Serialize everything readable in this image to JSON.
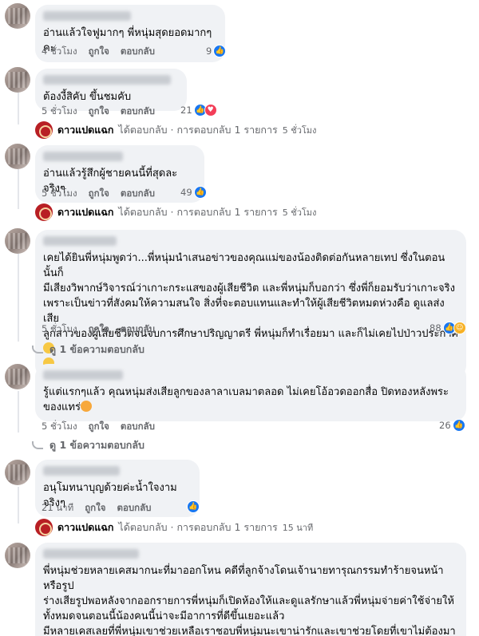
{
  "labels": {
    "like": "ถูกใจ",
    "reply": "ตอบกลับ",
    "replied_suffix": "ได้ตอบกลับ · การตอบกลับ 1 รายการ"
  },
  "page": {
    "name": "ดาวแปดแฉก"
  },
  "comments": [
    {
      "text": "อ่านแล้วใจฟูมากๆ พี่หนุ่มสุดยอดมากๆคะ",
      "time": "4 ชั่วโมง",
      "count": "9",
      "reactions": [
        "like"
      ]
    },
    {
      "text": "ต้องงี้สิคับ ขึ้นชมคับ",
      "time": "5 ชั่วโมง",
      "count": "21",
      "reactions": [
        "like",
        "love"
      ],
      "page_reply_time": "5 ชั่วโมง"
    },
    {
      "text": "อ่านแล้วรู้สึกผู้ชายคนนี้ที่สุดละจริงๆ",
      "time": "5 ชั่วโมง",
      "count": "49",
      "reactions": [
        "like"
      ],
      "page_reply_time": "5 ชั่วโมง"
    },
    {
      "text": "เคยได้ยินพี่หนุ่มพูดว่า...พี่หนุ่มนำเสนอข่าวของคุณแม่ของน้องติดต่อกันหลายเทป ซึ่งในตอนนั้นก็\nมีเสียงวิพากษ์วิจารณ์ว่าเกาะกระแสของผู้เสียชีวิต และพี่หนุ่มก็บอกว่า ซึ่งพี่ก็ยอมรับว่าเกาะจริง\nเพราะเป็นข่าวที่สังคมให้ความสนใจ สิ่งที่จะตอบแทนและทำให้ผู้เสียชีวิตหมดห่วงคือ ดูแลส่งเสีย\nลูกสาวของผู้เสียชีวิตจนจบการศึกษาปริญญาตรี พี่หนุ่มก็ทำเรื่อยมา และก็ไม่เคยไปป่าวประกาศ",
      "time": "5 ชั่วโมง",
      "count": "88",
      "reactions": [
        "like",
        "care"
      ],
      "view_replies": "ดู 1 ข้อความตอบกลับ"
    },
    {
      "text": "รู้แต่แรกๆแล้ว คุณหนุ่มส่งเสียลูกของลาลาเบลมาตลอด ไม่เคยโอ้อวดออกสื่อ ปิดทองหลังพระ\nของแทร่",
      "time": "5 ชั่วโมง",
      "count": "26",
      "reactions": [
        "like"
      ],
      "view_replies": "ดู 1 ข้อความตอบกลับ"
    },
    {
      "text": "อนุโมทนาบุญด้วยค่ะน้ำใจงามจริงๆ",
      "time": "21 นาที",
      "count": "",
      "reactions": [
        "like"
      ],
      "page_reply_time": "15 นาที"
    },
    {
      "text": "พี่หนุ่มช่วยหลายเคสมากนะที่มาออกโหน คดีที่ลูกจ้างโดนเจ้านายทารุณกรรมทำร้ายจนหน้าหรือรูป\nร่างเสียรูปพอหลังจากออกรายการพี่หนุ่มก็เปิดห้องให้และดูแลรักษาแล้วพี่หนุ่มจ่ายค่าใช้จ่ายให้\nทั้งหมดจนตอนนี้น้องคนนี้น่าจะมีอาการที่ดีขึ้นเยอะแล้ว\nมีหลายเคสเลยที่พี่หนุ่มเขาช่วยเหลือเราชอบพี่หนุ่มนะเขาน่ารักและเขาช่วยโดยที่เขาไม่ต้องมา\nป่าวประกาศด้วย"
    }
  ]
}
